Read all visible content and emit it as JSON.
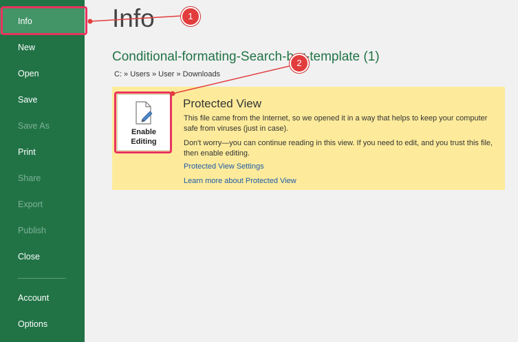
{
  "sidebar": {
    "items": [
      {
        "label": "Info",
        "state": "active"
      },
      {
        "label": "New",
        "state": "enabled"
      },
      {
        "label": "Open",
        "state": "enabled"
      },
      {
        "label": "Save",
        "state": "enabled"
      },
      {
        "label": "Save As",
        "state": "disabled"
      },
      {
        "label": "Print",
        "state": "enabled"
      },
      {
        "label": "Share",
        "state": "disabled"
      },
      {
        "label": "Export",
        "state": "disabled"
      },
      {
        "label": "Publish",
        "state": "disabled"
      },
      {
        "label": "Close",
        "state": "enabled"
      },
      {
        "label": "Account",
        "state": "enabled"
      },
      {
        "label": "Options",
        "state": "enabled"
      }
    ]
  },
  "main": {
    "title": "Info",
    "document_name": "Conditional-formating-Search-bar-template (1)",
    "breadcrumb": "C: » Users » User » Downloads"
  },
  "protected_view": {
    "button_line1": "Enable",
    "button_line2": "Editing",
    "heading": "Protected View",
    "description": "This file came from the Internet, so we opened it in a way that helps to keep your computer safe from viruses (just in case).",
    "advice": "Don't worry—you can continue reading in this view. If you need to edit, and you trust this file, then enable editing.",
    "settings_link": "Protected View Settings",
    "learn_more_link": "Learn more about Protected View"
  },
  "callouts": {
    "step1": "1",
    "step2": "2"
  },
  "colors": {
    "sidebar_bg": "#217346",
    "sidebar_active": "#439467",
    "panel_bg": "#fdeb9b",
    "highlight": "#e8335f",
    "badge": "#e23c3c",
    "link": "#1e5aa8"
  }
}
